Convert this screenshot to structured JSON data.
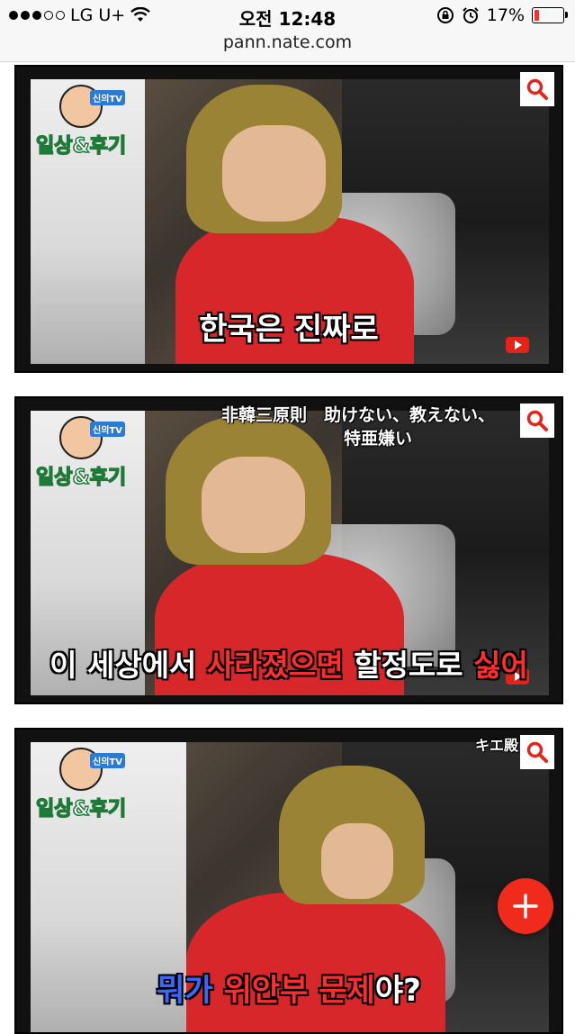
{
  "status_bar": {
    "carrier": "LG U+",
    "time": "오전 12:48",
    "battery_percent": "17%",
    "battery_level": 0.17,
    "signal_bars_filled": 3,
    "signal_bars_total": 5
  },
  "browser": {
    "url": "pann.nate.com"
  },
  "images": [
    {
      "logo_title": "일상&후기",
      "caption_parts": [
        {
          "text": "한국은 진짜로",
          "style": "white"
        }
      ],
      "overlay_text": []
    },
    {
      "logo_title": "일상&후기",
      "caption_parts": [
        {
          "text": "이 세상에서 ",
          "style": "white"
        },
        {
          "text": "사라졌으면",
          "style": "red"
        },
        {
          "text": " 할정도로 ",
          "style": "white"
        },
        {
          "text": "싫어",
          "style": "red"
        }
      ],
      "overlay_text": [
        "非韓三原則　助けない、教えない、",
        "特亜嫌い"
      ]
    },
    {
      "logo_title": "일상&후기",
      "caption_parts": [
        {
          "text": "뭐가 ",
          "style": "blue"
        },
        {
          "text": "위안부 문제",
          "style": "red"
        },
        {
          "text": "야?",
          "style": "white"
        }
      ],
      "overlay_text": [
        "キエ殿"
      ]
    }
  ],
  "colors": {
    "accent_red": "#f12b1c",
    "caption_red": "#ff2e2e",
    "caption_blue": "#3a67ff"
  },
  "icons": {
    "zoom": "magnifier-icon",
    "fab": "plus-icon"
  }
}
